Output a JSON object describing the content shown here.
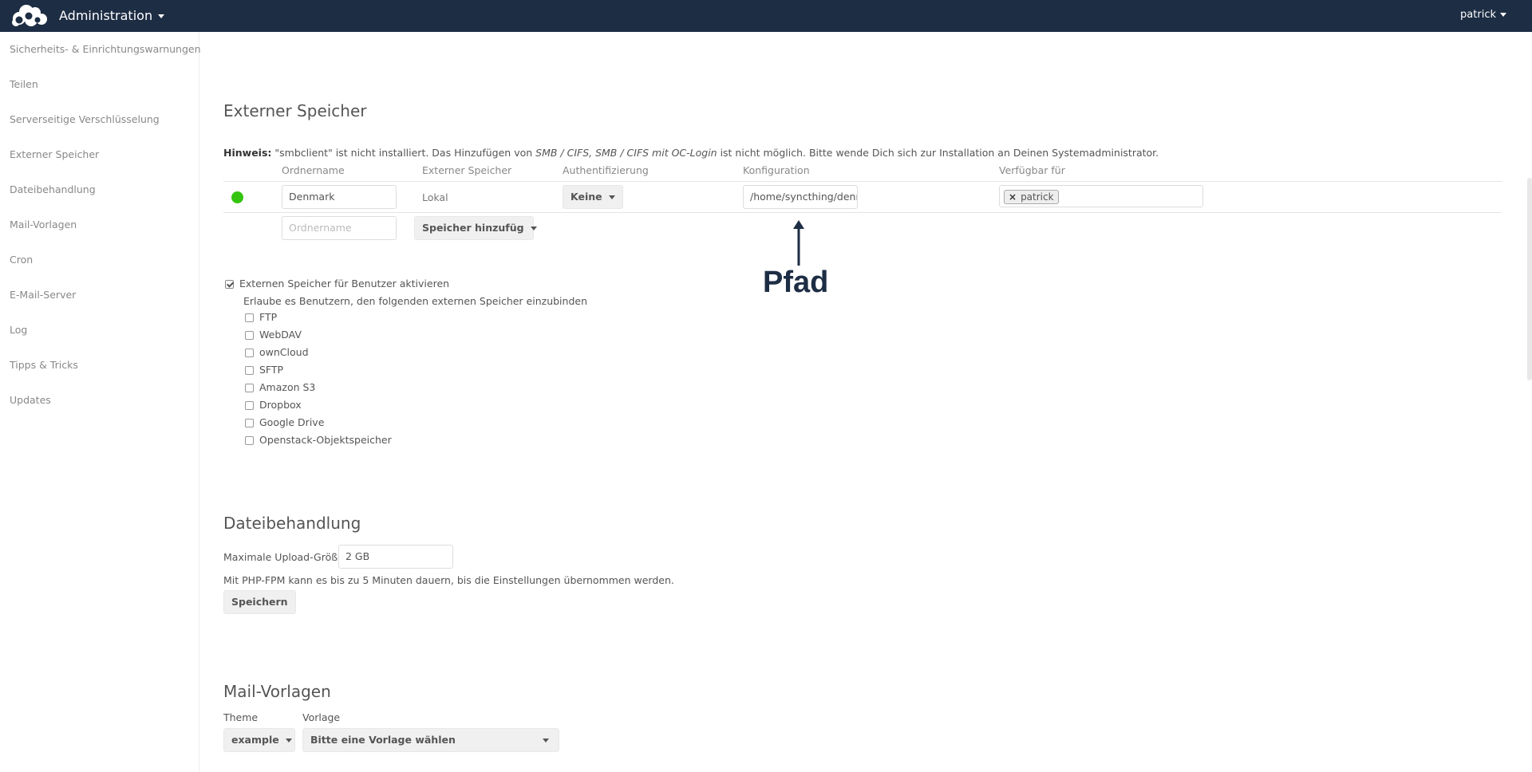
{
  "header": {
    "app_title": "Administration",
    "user": "patrick"
  },
  "sidebar": {
    "items": [
      "Sicherheits- & Einrichtungswarnungen",
      "Teilen",
      "Serverseitige Verschlüsselung",
      "Externer Speicher",
      "Dateibehandlung",
      "Mail-Vorlagen",
      "Cron",
      "E-Mail-Server",
      "Log",
      "Tipps & Tricks",
      "Updates"
    ]
  },
  "external_storage": {
    "title": "Externer Speicher",
    "hint_label": "Hinweis:",
    "hint_text_1": " \"smbclient\" ist nicht installiert. Das Hinzufügen von ",
    "hint_em": "SMB / CIFS, SMB / CIFS mit OC-Login",
    "hint_text_2": " ist nicht möglich. Bitte wende Dich sich zur Installation an Deinen Systemadministrator.",
    "columns": [
      "Ordnername",
      "Externer Speicher",
      "Authentifizierung",
      "Konfiguration",
      "Verfügbar für"
    ],
    "row": {
      "folder_name": "Denmark",
      "storage": "Lokal",
      "auth": "Keine",
      "config": "/home/syncthing/denr",
      "available_for": "patrick",
      "status_color": "#34c30f"
    },
    "new_row": {
      "folder_placeholder": "Ordnername",
      "add_storage": "Speicher hinzufüg"
    },
    "enable_user_label": "Externen Speicher für Benutzer aktivieren",
    "enable_user_checked": true,
    "allow_text": "Erlaube es Benutzern, den folgenden externen Speicher einzubinden",
    "backends": [
      "FTP",
      "WebDAV",
      "ownCloud",
      "SFTP",
      "Amazon S3",
      "Dropbox",
      "Google Drive",
      "Openstack-Objektspeicher"
    ]
  },
  "annotation": {
    "text": "Pfad",
    "color": "#1d2d44"
  },
  "file_handling": {
    "title": "Dateibehandlung",
    "upload_label": "Maximale Upload-Größe",
    "upload_value": "2 GB",
    "note": "Mit PHP-FPM kann es bis zu 5 Minuten dauern, bis die Einstellungen übernommen werden.",
    "save": "Speichern"
  },
  "mail_templates": {
    "title": "Mail-Vorlagen",
    "theme_label": "Theme",
    "template_label": "Vorlage",
    "theme_value": "example",
    "template_value": "Bitte eine Vorlage wählen"
  },
  "colors": {
    "header_bg": "#1d2d44",
    "status_ok": "#34c30f"
  }
}
